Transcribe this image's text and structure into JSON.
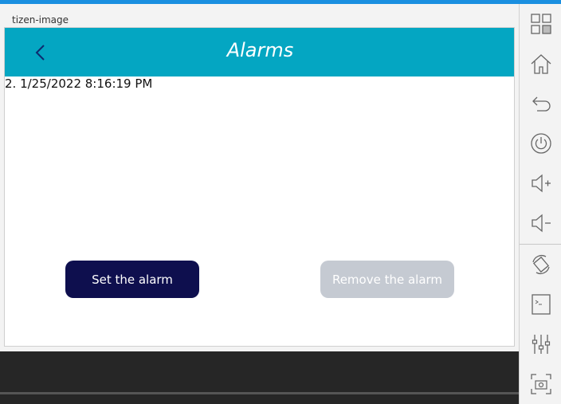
{
  "window": {
    "title": "tizen-image"
  },
  "appbar": {
    "title": "Alarms",
    "back_icon": "chevron-left-icon"
  },
  "alarms": [
    {
      "label": "2. 1/25/2022 8:16:19 PM"
    }
  ],
  "buttons": {
    "set_label": "Set the alarm",
    "remove_label": "Remove the alarm"
  },
  "colors": {
    "appbar": "#04a6c2",
    "set_button": "#0e0f4e",
    "remove_button": "#c5cad2",
    "top_stripe": "#1a8fe0"
  },
  "sidebar": {
    "icons": [
      "apps-grid-icon",
      "home-icon",
      "back-arrow-icon",
      "power-icon",
      "volume-up-icon",
      "volume-down-icon",
      "rotate-icon",
      "terminal-icon",
      "settings-sliders-icon",
      "screenshot-icon"
    ]
  }
}
